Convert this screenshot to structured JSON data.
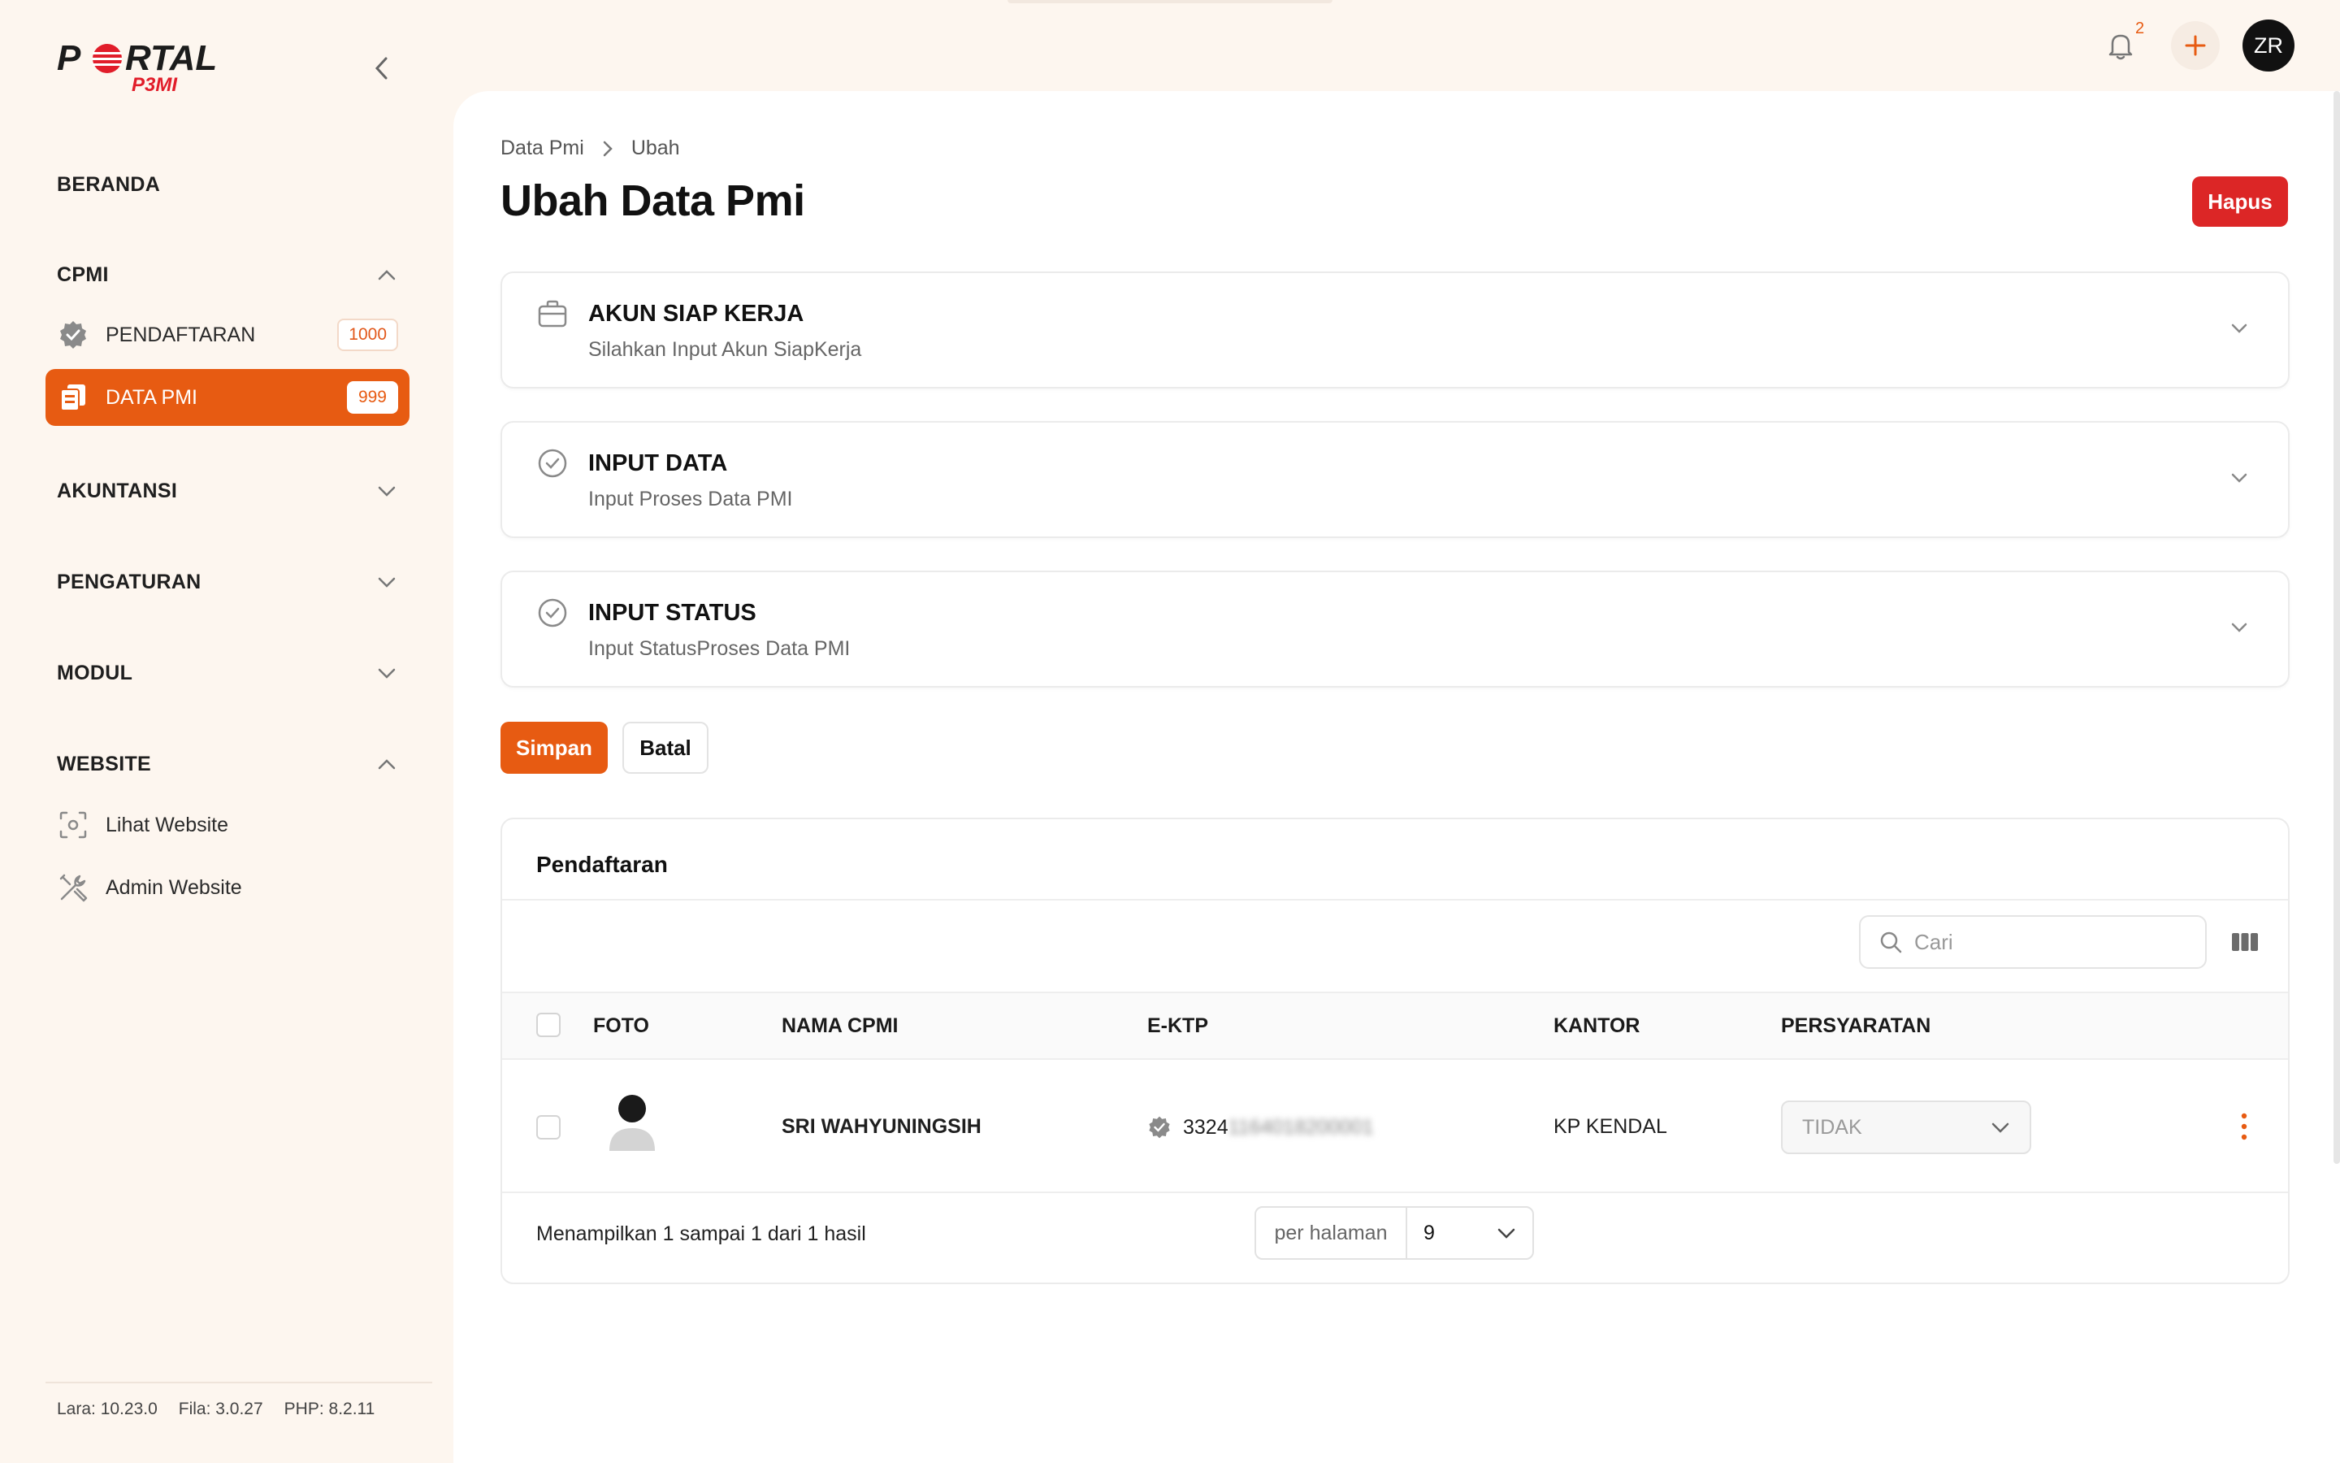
{
  "brand": {
    "logo_main": "PORTAL",
    "logo_sub": "P3MI"
  },
  "sidebar": {
    "beranda": "BERANDA",
    "groups": {
      "cpmi": "CPMI",
      "akuntansi": "AKUNTANSI",
      "pengaturan": "PENGATURAN",
      "modul": "MODUL",
      "website": "WEBSITE"
    },
    "items": {
      "pendaftaran": {
        "label": "PENDAFTARAN",
        "badge": "1000"
      },
      "data_pmi": {
        "label": "DATA PMI",
        "badge": "999"
      },
      "lihat_website": {
        "label": "Lihat Website"
      },
      "admin_website": {
        "label": "Admin Website"
      }
    },
    "versions": {
      "lara": "Lara: 10.23.0",
      "fila": "Fila: 3.0.27",
      "php": "PHP: 8.2.11"
    }
  },
  "topbar": {
    "notification_count": "2",
    "avatar_initials": "ZR"
  },
  "breadcrumb": {
    "parent": "Data Pmi",
    "current": "Ubah"
  },
  "page": {
    "title": "Ubah Data Pmi",
    "delete_label": "Hapus"
  },
  "sections": [
    {
      "title": "AKUN SIAP KERJA",
      "subtitle": "Silahkan Input Akun SiapKerja",
      "icon": "briefcase-icon"
    },
    {
      "title": "INPUT DATA",
      "subtitle": "Input Proses Data PMI",
      "icon": "check-circle-icon"
    },
    {
      "title": "INPUT STATUS",
      "subtitle": "Input StatusProses Data PMI",
      "icon": "check-circle-icon"
    }
  ],
  "actions": {
    "save": "Simpan",
    "cancel": "Batal"
  },
  "table": {
    "title": "Pendaftaran",
    "search_placeholder": "Cari",
    "columns": [
      "FOTO",
      "NAMA CPMI",
      "E-KTP",
      "KANTOR",
      "PERSYARATAN"
    ],
    "rows": [
      {
        "nama": "SRI WAHYUNINGSIH",
        "ektp_visible": "3324",
        "ektp_masked": "1164018200001",
        "kantor": "KP KENDAL",
        "persyaratan": "TIDAK"
      }
    ],
    "footer": "Menampilkan 1 sampai 1 dari 1 hasil",
    "per_page_label": "per halaman",
    "per_page_value": "9"
  },
  "colors": {
    "accent": "#e75b12",
    "danger": "#dc2626",
    "background": "#fdf6ef"
  }
}
